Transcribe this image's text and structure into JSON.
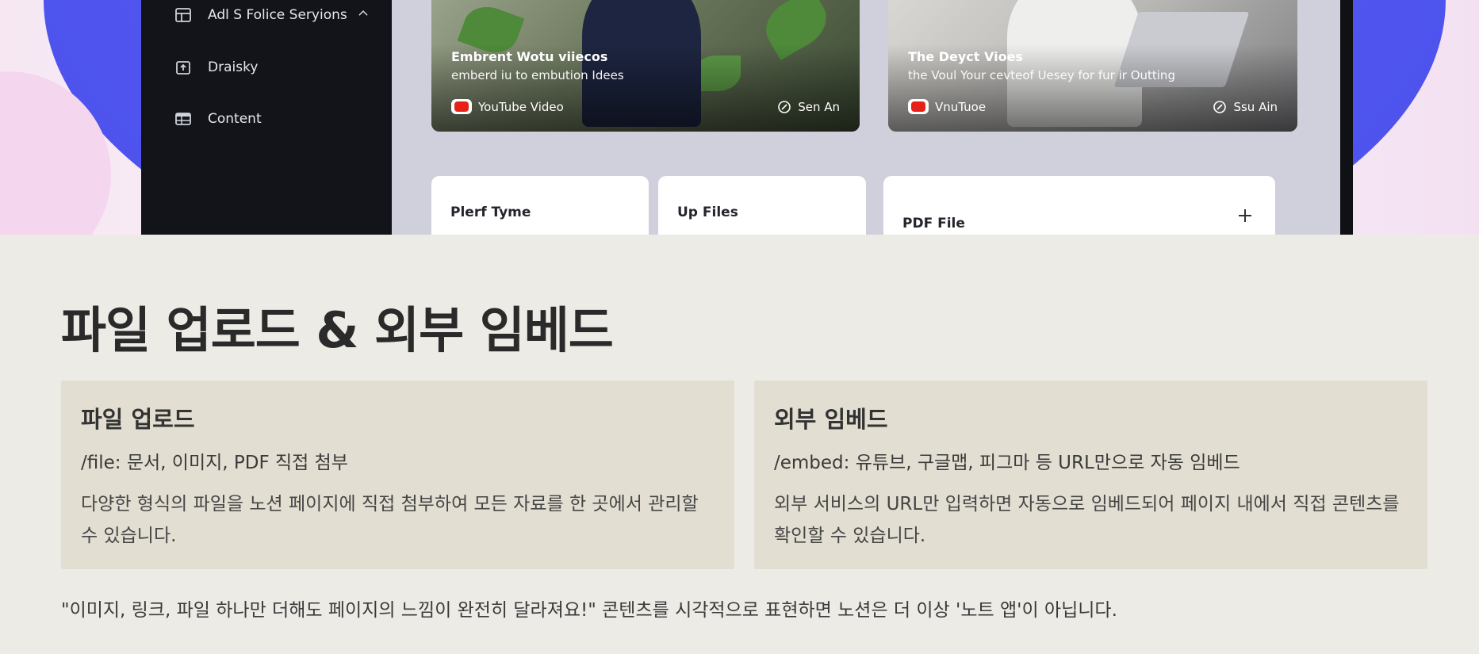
{
  "hero": {
    "sidebar": {
      "items": [
        {
          "label": "Adl S Folice Seryions",
          "icon": "layout-icon",
          "has_chevron": true
        },
        {
          "label": "Draisky",
          "icon": "upload-icon"
        },
        {
          "label": "Content",
          "icon": "table-icon"
        }
      ]
    },
    "video_cards": [
      {
        "title": "Embrent Wotu viiecos",
        "subtitle": "emberd iu to embution Idees",
        "brand": "YouTube Video",
        "author": "Sen An"
      },
      {
        "title": "The Deyct Vioes",
        "subtitle": "the Voul Your cevteof Uesey for fur ir Outting",
        "brand": "VnuTuoe",
        "author": "Ssu Ain"
      }
    ],
    "tiles": [
      {
        "label": "Plerf Tyme"
      },
      {
        "label": "Up Files"
      },
      {
        "label": "PDF File",
        "icon": "plus-icon"
      }
    ]
  },
  "page": {
    "title": "파일 업로드 & 외부 임베드",
    "cards": [
      {
        "title": "파일 업로드",
        "subtitle": "/file: 문서, 이미지, PDF 직접 첨부",
        "description": "다양한 형식의 파일을 노션 페이지에 직접 첨부하여 모든 자료를 한 곳에서 관리할 수 있습니다."
      },
      {
        "title": "외부 임베드",
        "subtitle": "/embed: 유튜브, 구글맵, 피그마 등 URL만으로 자동 임베드",
        "description": "외부 서비스의 URL만 입력하면 자동으로 임베드되어 페이지 내에서 직접 콘텐츠를 확인할 수 있습니다."
      }
    ],
    "quote": "\"이미지, 링크, 파일 하나만 더해도 페이지의 느낌이 완전히 달라져요!\" 콘텐츠를 시각적으로 표현하면 노션은 더 이상 '노트 앱'이 아닙니다."
  },
  "colors": {
    "page_background": "#edebe6",
    "card_background": "#e3ded2",
    "hero_blob": "#5156ef",
    "app_sidebar": "#121419",
    "youtube_red": "#e62117"
  }
}
